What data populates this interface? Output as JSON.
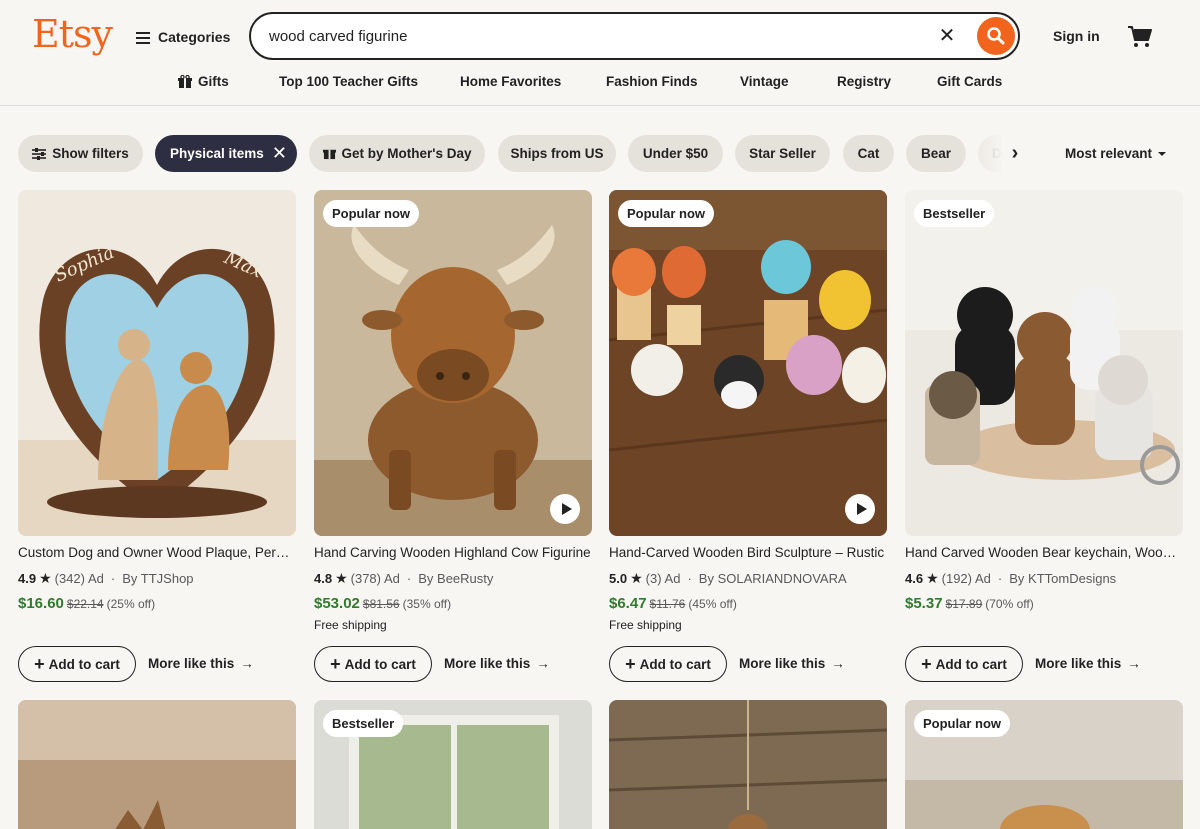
{
  "header": {
    "logo": "Etsy",
    "categories_label": "Categories",
    "search_value": "wood carved figurine",
    "sign_in": "Sign in"
  },
  "nav": {
    "items": [
      "Gifts",
      "Top 100 Teacher Gifts",
      "Home Favorites",
      "Fashion Finds",
      "Vintage",
      "Registry",
      "Gift Cards"
    ]
  },
  "filters": {
    "show_filters": "Show filters",
    "chips": [
      "Physical items",
      "Get by Mother's Day",
      "Ships from US",
      "Under $50",
      "Star Seller",
      "Cat",
      "Bear",
      "De"
    ],
    "active_chip": "Physical items",
    "sort": "Most relevant"
  },
  "listings": [
    {
      "badge": "",
      "has_video": false,
      "title": "Custom Dog and Owner Wood Plaque, Personalized",
      "rating": "4.9",
      "reviews": "(342)",
      "ad": "Ad",
      "shop": "By TTJShop",
      "price": "$16.60",
      "original_price": "$22.14",
      "discount": "(25% off)",
      "shipping": "",
      "add_to_cart": "Add to cart",
      "more_like_this": "More like this"
    },
    {
      "badge": "Popular now",
      "has_video": true,
      "title": "Hand Carving Wooden Highland Cow Figurine",
      "rating": "4.8",
      "reviews": "(378)",
      "ad": "Ad",
      "shop": "By BeeRusty",
      "price": "$53.02",
      "original_price": "$81.56",
      "discount": "(35% off)",
      "shipping": "Free shipping",
      "add_to_cart": "Add to cart",
      "more_like_this": "More like this"
    },
    {
      "badge": "Popular now",
      "has_video": true,
      "title": "Hand-Carved Wooden Bird Sculpture – Rustic",
      "rating": "5.0",
      "reviews": "(3)",
      "ad": "Ad",
      "shop": "By SOLARIANDNOVARA",
      "price": "$6.47",
      "original_price": "$11.76",
      "discount": "(45% off)",
      "shipping": "Free shipping",
      "add_to_cart": "Add to cart",
      "more_like_this": "More like this"
    },
    {
      "badge": "Bestseller",
      "has_video": false,
      "title": "Hand Carved Wooden Bear keychain, Wooden",
      "rating": "4.6",
      "reviews": "(192)",
      "ad": "Ad",
      "shop": "By KTTomDesigns",
      "price": "$5.37",
      "original_price": "$17.89",
      "discount": "(70% off)",
      "shipping": "",
      "add_to_cart": "Add to cart",
      "more_like_this": "More like this"
    }
  ],
  "row2_badges": [
    "",
    "Bestseller",
    "",
    "Popular now"
  ],
  "colors": {
    "brand": "#f1641e",
    "price": "#2f7a2e",
    "chip_active": "#2e2e42",
    "background": "#f8f6f2"
  },
  "icons": [
    "menu-icon",
    "clear-icon",
    "search-icon",
    "cart-icon",
    "gift-icon",
    "filter-icon",
    "close-icon",
    "chevron-right-icon",
    "caret-down-icon",
    "star-icon",
    "plus-icon",
    "arrow-right-icon",
    "play-icon"
  ]
}
